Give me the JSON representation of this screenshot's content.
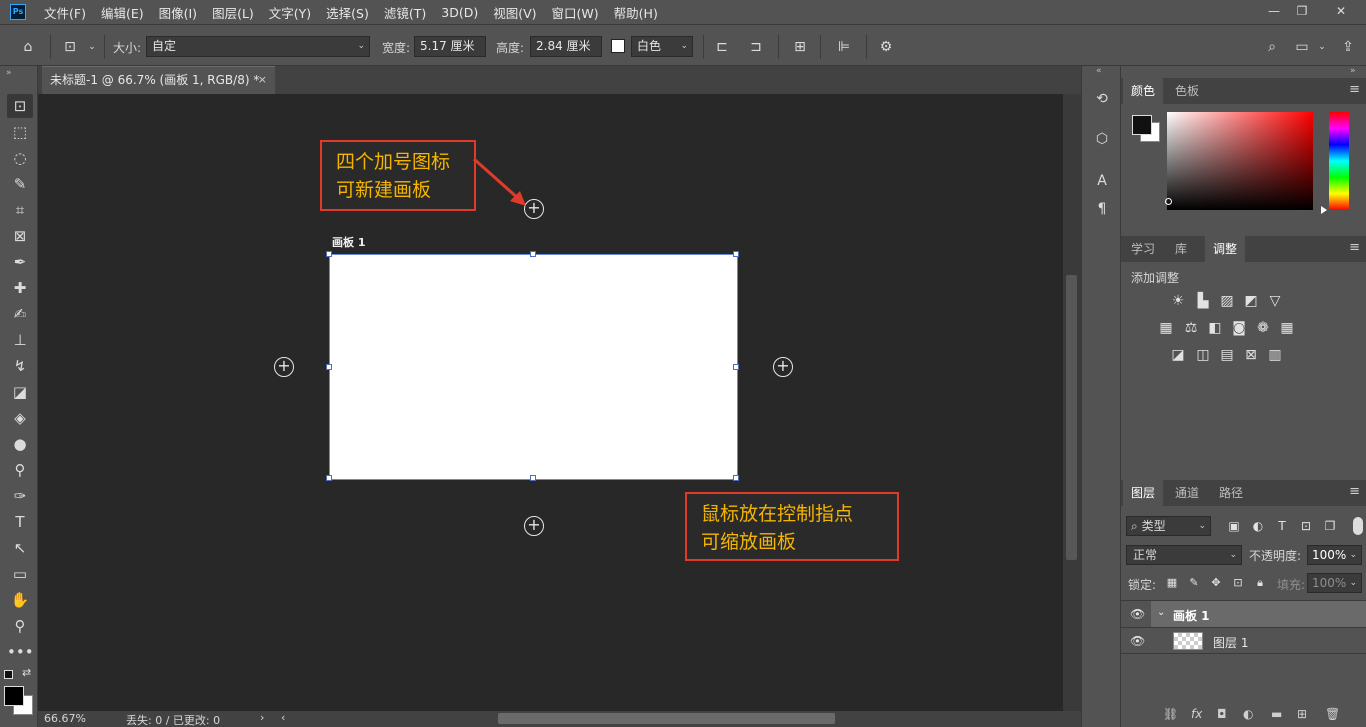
{
  "app": {
    "logo": "Ps",
    "menu": [
      "文件(F)",
      "编辑(E)",
      "图像(I)",
      "图层(L)",
      "文字(Y)",
      "选择(S)",
      "滤镜(T)",
      "3D(D)",
      "视图(V)",
      "窗口(W)",
      "帮助(H)"
    ]
  },
  "options": {
    "size_label": "大小:",
    "size_value": "自定",
    "width_label": "宽度:",
    "width_value": "5.17 厘米",
    "height_label": "高度:",
    "height_value": "2.84 厘米",
    "bg_value": "白色"
  },
  "document": {
    "tab_title": "未标题-1 @ 66.7% (画板 1, RGB/8) *",
    "close": "×",
    "artboard_label": "画板 1",
    "annotation_top": [
      "四个加号图标",
      "可新建画板"
    ],
    "annotation_bottom": [
      "鼠标放在控制指点",
      "可缩放画板"
    ],
    "plus": "+"
  },
  "status": {
    "zoom": "66.67%",
    "info": "丢失: 0 / 已更改: 0"
  },
  "panels": {
    "color_tabs": [
      "颜色",
      "色板"
    ],
    "adjust_tabs": [
      "学习",
      "库",
      "调整"
    ],
    "adjust_title": "添加调整",
    "layers_tabs": [
      "图层",
      "通道",
      "路径"
    ],
    "filter_type": "类型",
    "blend_mode": "正常",
    "opacity_label": "不透明度:",
    "opacity_value": "100%",
    "lock_label": "锁定:",
    "fill_label": "填充:",
    "fill_value": "100%",
    "layers": [
      {
        "name": "画板 1",
        "type": "artboard"
      },
      {
        "name": "图层 1",
        "type": "layer"
      }
    ]
  },
  "colors": {
    "accent_red": "#e03a2a",
    "annotation_text": "#f4b400",
    "canvas_bg": "#282828",
    "panel_bg": "#535353"
  }
}
